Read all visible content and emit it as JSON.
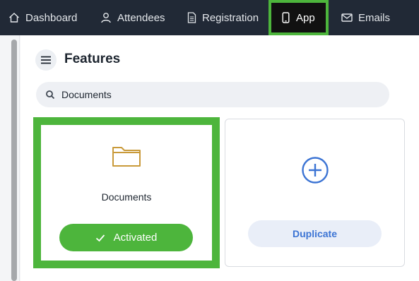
{
  "nav": {
    "items": [
      {
        "label": "Dashboard",
        "icon": "home-icon"
      },
      {
        "label": "Attendees",
        "icon": "person-icon"
      },
      {
        "label": "Registration",
        "icon": "document-icon"
      },
      {
        "label": "App",
        "icon": "phone-icon",
        "active": true
      },
      {
        "label": "Emails",
        "icon": "mail-icon"
      }
    ]
  },
  "page": {
    "title": "Features"
  },
  "search": {
    "value": "Documents"
  },
  "cards": [
    {
      "label": "Documents",
      "icon": "folder-icon",
      "button": "Activated"
    },
    {
      "icon": "plus-circle-icon",
      "button": "Duplicate"
    }
  ],
  "colors": {
    "nav_bg": "#212936",
    "accent_green": "#4db53c",
    "folder": "#c99a3a",
    "blue": "#3c74d4"
  }
}
